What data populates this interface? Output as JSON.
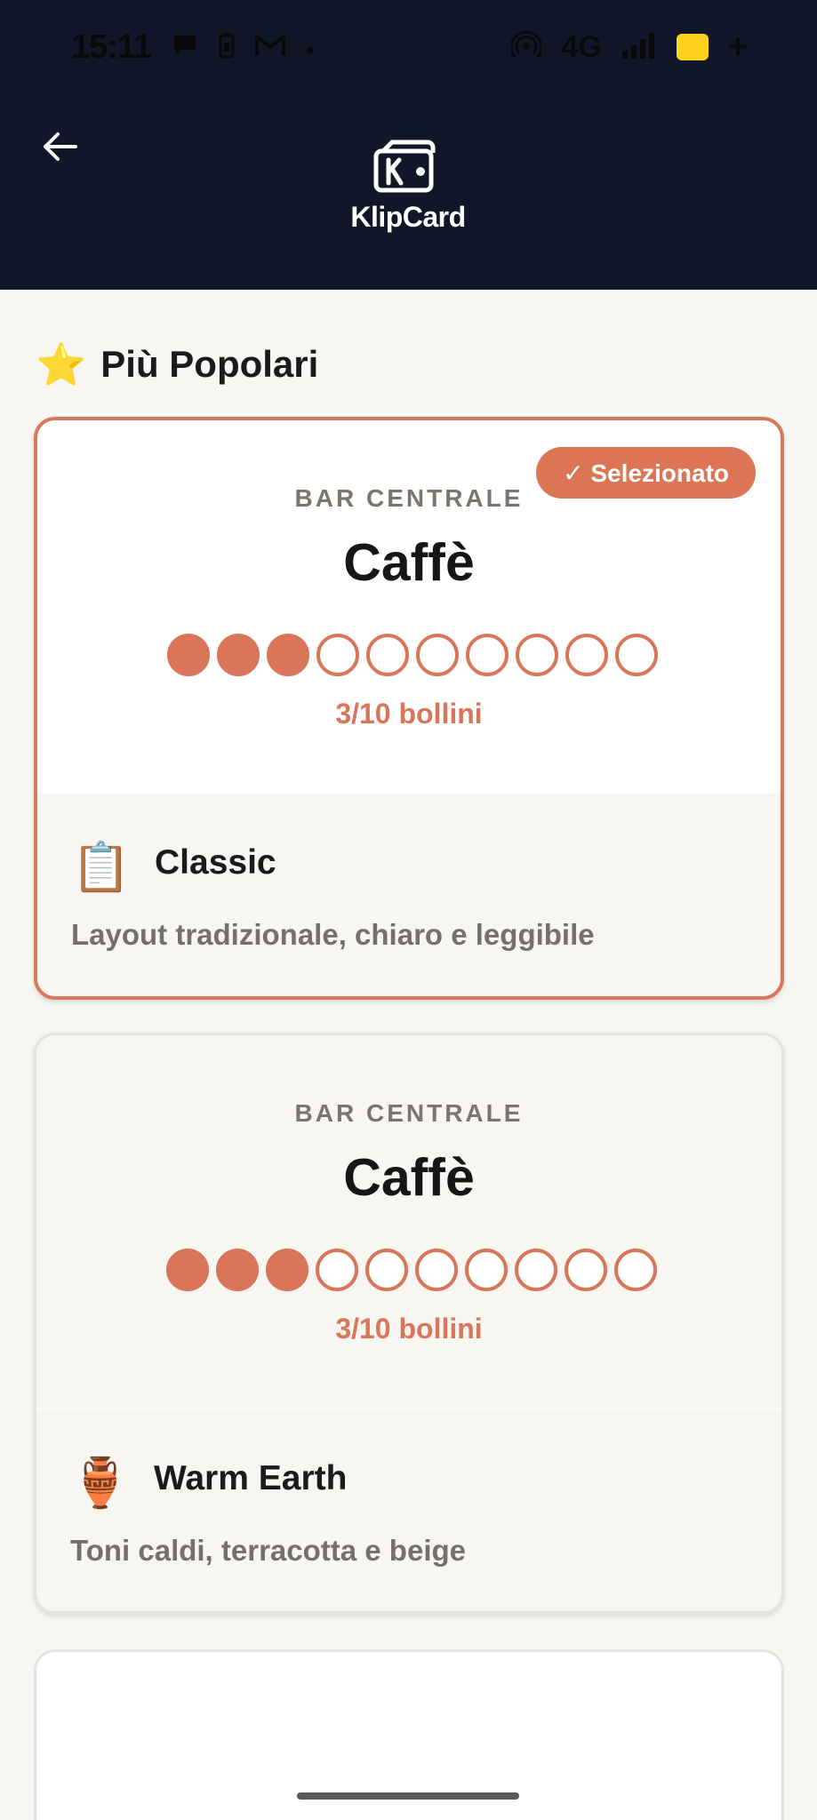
{
  "status_bar": {
    "time": "15:11",
    "network": "4G"
  },
  "header": {
    "logo_text": "KlipCard"
  },
  "section": {
    "icon": "⭐",
    "title": "Più Popolari"
  },
  "cards": [
    {
      "badge": "✓ Selezionato",
      "venue": "BAR CENTRALE",
      "product": "Caffè",
      "stamps_filled": 3,
      "stamps_total": 10,
      "stamps_text": "3/10 bollini",
      "template_emoji": "📋",
      "template_name": "Classic",
      "template_description": "Layout tradizionale, chiaro e leggibile"
    },
    {
      "venue": "BAR CENTRALE",
      "product": "Caffè",
      "stamps_filled": 3,
      "stamps_total": 10,
      "stamps_text": "3/10 bollini",
      "template_emoji": "🏺",
      "template_name": "Warm Earth",
      "template_description": "Toni caldi, terracotta e beige"
    }
  ],
  "colors": {
    "header_bg": "#111729",
    "accent": "#d9765a",
    "page_bg": "#f7f6f3"
  }
}
